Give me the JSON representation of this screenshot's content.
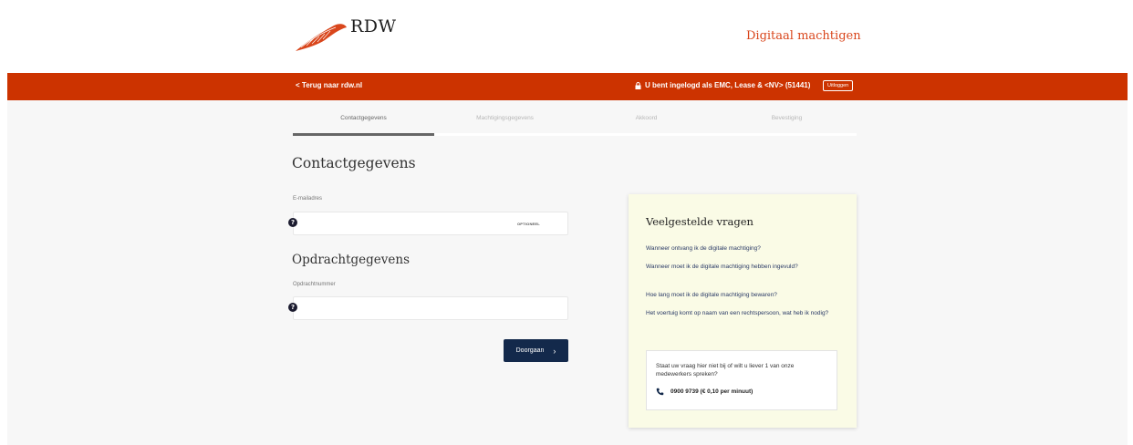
{
  "header": {
    "logo_text": "RDW",
    "app_title": "Digitaal machtigen"
  },
  "topbar": {
    "back_link": "< Terug naar rdw.nl",
    "login_info": "U bent ingelogd als EMC, Lease & <NV> (51441)",
    "logout_label": "Uitloggen"
  },
  "steps": [
    {
      "label": "Contactgegevens",
      "active": true
    },
    {
      "label": "Machtigingsgegevens",
      "active": false
    },
    {
      "label": "Akkoord",
      "active": false
    },
    {
      "label": "Bevestiging",
      "active": false
    }
  ],
  "progress_fraction": 0.25,
  "contact": {
    "title": "Contactgegevens",
    "email_label": "E-mailadres",
    "email_value": "",
    "email_optional": "OPTIONEEL"
  },
  "order": {
    "title": "Opdrachtgegevens",
    "number_label": "Opdrachtnummer",
    "number_value": ""
  },
  "continue_button": "Doorgaan",
  "faq": {
    "title": "Veelgestelde vragen",
    "items": [
      "Wanneer ontvang ik de digitale machtiging?",
      "Wanneer moet ik de digitale machtiging hebben ingevuld?",
      "Hoe lang moet ik de digitale machtiging bewaren?",
      "Het voertuig komt op naam van een rechtspersoon, wat heb ik nodig?"
    ],
    "contact_text": "Staat uw vraag hier niet bij of wilt u liever 1 van onze medewerkers spreken?",
    "phone": "0900 9739 (€ 0,10 per minuut)"
  },
  "colors": {
    "brand_red": "#cc3300",
    "title_orange": "#d9461c",
    "button_navy": "#13294b",
    "faq_bg": "#fafbe6"
  },
  "icons": [
    "rdw-feather-logo",
    "lock-icon",
    "help-icon",
    "chevron-right-icon",
    "phone-icon"
  ]
}
